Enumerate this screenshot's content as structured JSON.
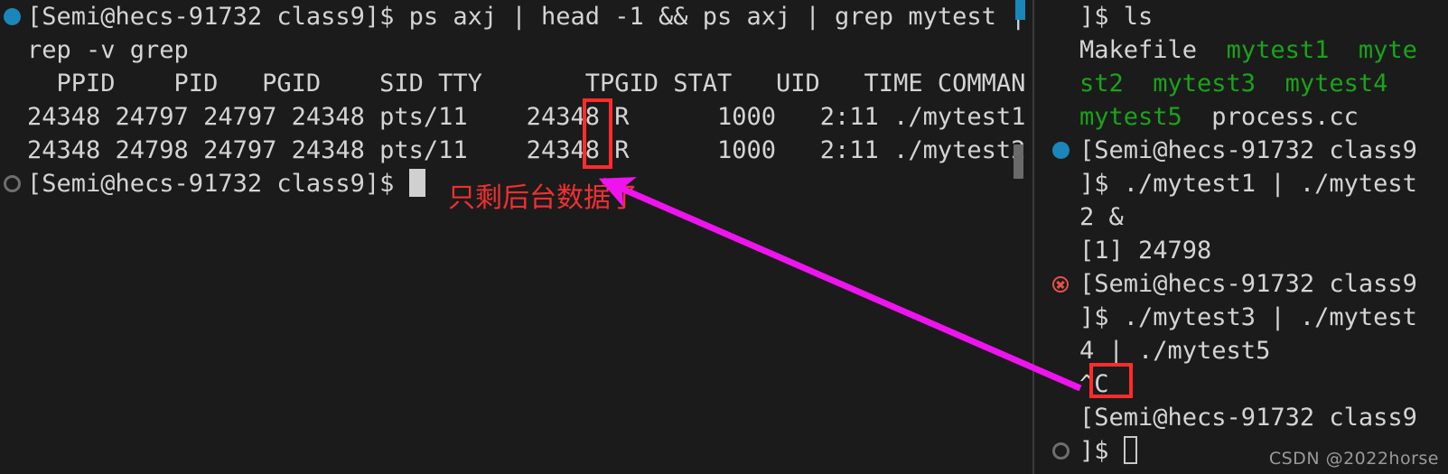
{
  "colors": {
    "background": "#1b1b1b",
    "foreground": "#d4d4d4",
    "green": "#19a319",
    "annotation_red": "#f03030",
    "box_red": "#fc2c2c",
    "arrow_magenta": "#ee14ee",
    "marker_blue": "#1b86b8",
    "marker_error": "#e8504a",
    "divider": "#3a3a3a",
    "watermark": "#9a9a9a"
  },
  "left_pane": {
    "name": "left-terminal-pane",
    "lines": [
      {
        "marker": "dot-active",
        "text": "[Semi@hecs-91732 class9]$ ps axj | head -1 && ps axj | grep mytest | g"
      },
      {
        "marker": "none",
        "text": "rep -v grep"
      },
      {
        "marker": "none",
        "text": "  PPID    PID   PGID    SID TTY       TPGID STAT   UID   TIME COMMAND"
      },
      {
        "marker": "none",
        "text": "24348 24797 24797 24348 pts/11    24348 R      1000   2:11 ./mytest1"
      },
      {
        "marker": "none",
        "text": "24348 24798 24797 24348 pts/11    24348 R      1000   2:11 ./mytest2"
      },
      {
        "marker": "dot-idle",
        "text": "[Semi@hecs-91732 class9]$ ",
        "cursor": "block"
      }
    ]
  },
  "right_pane": {
    "name": "right-terminal-pane",
    "lines": [
      {
        "marker": "none",
        "segments": [
          {
            "text": "]$ ls",
            "style": "txt"
          }
        ]
      },
      {
        "marker": "none",
        "segments": [
          {
            "text": "Makefile  ",
            "style": "txt"
          },
          {
            "text": "mytest1  myte",
            "style": "green"
          }
        ]
      },
      {
        "marker": "none",
        "segments": [
          {
            "text": "st2  mytest3  mytest4",
            "style": "green"
          }
        ]
      },
      {
        "marker": "none",
        "segments": [
          {
            "text": "mytest5",
            "style": "green"
          },
          {
            "text": "  process.cc",
            "style": "txt"
          }
        ]
      },
      {
        "marker": "dot-active",
        "segments": [
          {
            "text": "[Semi@hecs-91732 class9",
            "style": "txt"
          }
        ]
      },
      {
        "marker": "none",
        "segments": [
          {
            "text": "]$ ./mytest1 | ./mytest",
            "style": "txt"
          }
        ]
      },
      {
        "marker": "none",
        "segments": [
          {
            "text": "2 &",
            "style": "txt"
          }
        ]
      },
      {
        "marker": "none",
        "segments": [
          {
            "text": "[1] 24798",
            "style": "txt"
          }
        ]
      },
      {
        "marker": "err",
        "segments": [
          {
            "text": "[Semi@hecs-91732 class9",
            "style": "txt"
          }
        ]
      },
      {
        "marker": "none",
        "segments": [
          {
            "text": "]$ ./mytest3 | ./mytest",
            "style": "txt"
          }
        ]
      },
      {
        "marker": "none",
        "segments": [
          {
            "text": "4 | ./mytest5",
            "style": "txt"
          }
        ]
      },
      {
        "marker": "none",
        "segments": [
          {
            "text": "^C",
            "style": "txt"
          }
        ]
      },
      {
        "marker": "none",
        "segments": [
          {
            "text": "[Semi@hecs-91732 class9",
            "style": "txt"
          }
        ]
      },
      {
        "marker": "dot-idle",
        "segments": [
          {
            "text": "]$ ",
            "style": "txt"
          }
        ],
        "cursor": "outline"
      }
    ]
  },
  "annotations": {
    "chinese_note": "只剩后台数据了",
    "stat_box_label": "R",
    "ctrlc_box_label": "^C"
  },
  "watermark": {
    "text": "CSDN @2022horse"
  }
}
